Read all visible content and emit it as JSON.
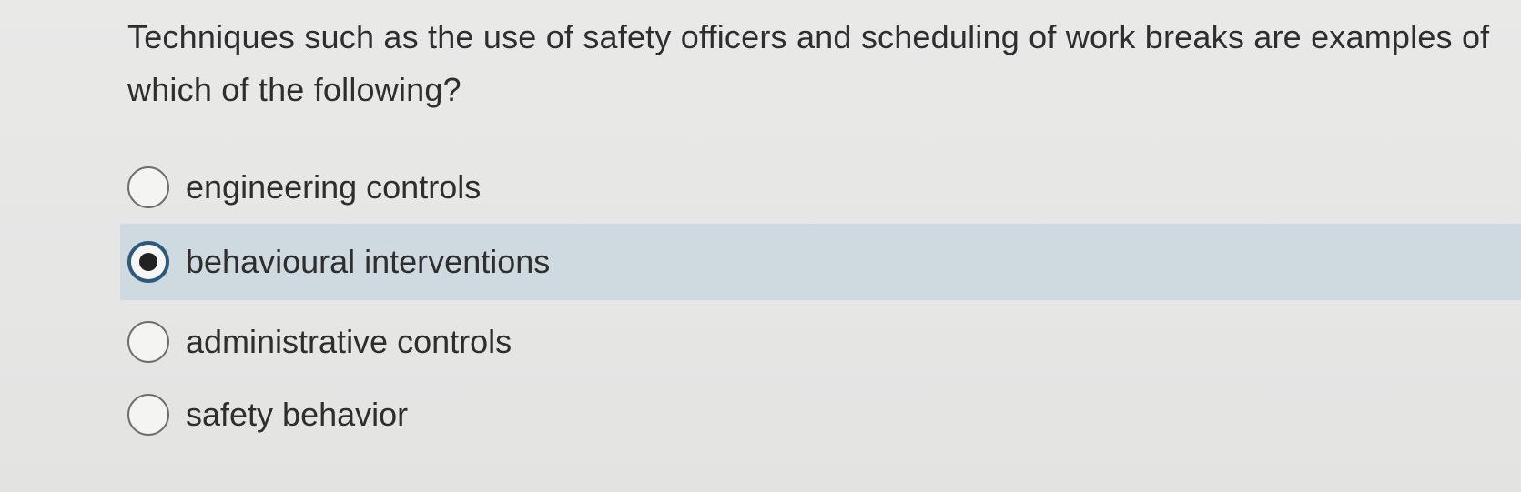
{
  "question": {
    "text": "Techniques such as the use of safety officers and scheduling of work breaks are examples of which of the following?"
  },
  "options": [
    {
      "label": "engineering controls",
      "selected": false
    },
    {
      "label": "behavioural interventions",
      "selected": true
    },
    {
      "label": "administrative controls",
      "selected": false
    },
    {
      "label": "safety behavior",
      "selected": false
    }
  ],
  "colors": {
    "selected_highlight": "#cfd9e0",
    "selected_ring": "#2b5a7a",
    "background": "#e7e7e6"
  }
}
